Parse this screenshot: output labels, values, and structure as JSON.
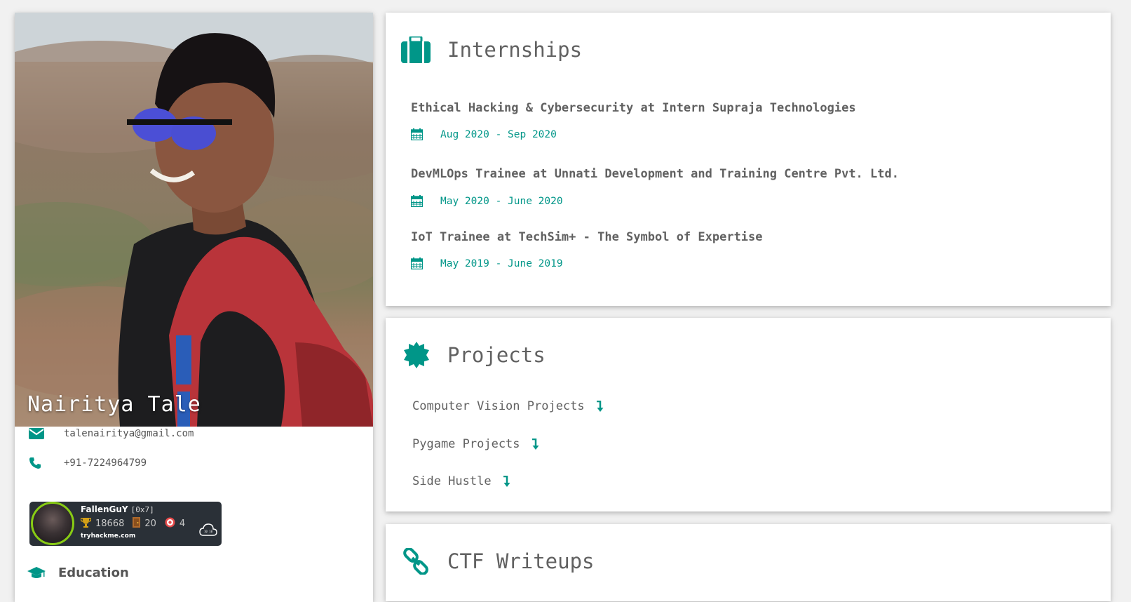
{
  "profile": {
    "name": "Nairitya Tale",
    "email": "talenairitya@gmail.com",
    "phone": "+91-7224964799",
    "education_label": "Education"
  },
  "badge": {
    "username": "FallenGuY",
    "rank": "[0x7]",
    "points": "18668",
    "rooms": "20",
    "badges": "4",
    "site": "tryhackme.com"
  },
  "internships": {
    "title": "Internships",
    "items": [
      {
        "title": "Ethical Hacking & Cybersecurity at Intern Supraja Technologies",
        "date": "Aug 2020 - Sep 2020"
      },
      {
        "title": "DevMLOps Trainee at Unnati Development and Training Centre Pvt. Ltd.",
        "date": "May 2020 - June 2020"
      },
      {
        "title": "IoT Trainee at TechSim+ - The Symbol of Expertise",
        "date": "May 2019 - June 2019"
      }
    ]
  },
  "projects": {
    "title": "Projects",
    "items": [
      {
        "label": "Computer Vision Projects"
      },
      {
        "label": "Pygame Projects"
      },
      {
        "label": "Side Hustle"
      }
    ]
  },
  "ctf": {
    "title": "CTF Writeups"
  },
  "colors": {
    "accent": "#009688",
    "text": "#616161",
    "background": "#f1f1f1",
    "badge_bg": "#2a3037",
    "badge_ring": "#88cc14"
  },
  "icons": {
    "email": "envelope-icon",
    "phone": "phone-icon",
    "education": "graduation-cap-icon",
    "internships": "suitcase-icon",
    "projects": "certificate-icon",
    "ctf": "chain-link-icon",
    "date": "calendar-icon",
    "project_link": "arrow-down-icon"
  }
}
